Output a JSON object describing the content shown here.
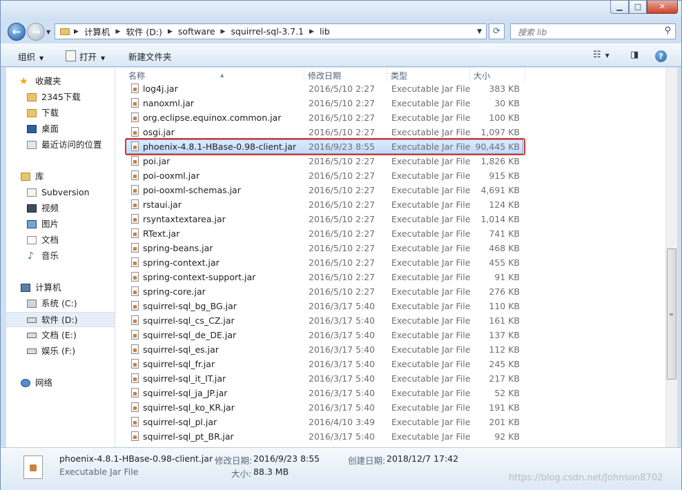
{
  "breadcrumbs": [
    "计算机",
    "软件 (D:)",
    "software",
    "squirrel-sql-3.7.1",
    "lib"
  ],
  "search": {
    "placeholder": "搜索 lib"
  },
  "toolbar": {
    "organize": "组织",
    "open": "打开",
    "new_folder": "新建文件夹"
  },
  "sidebar": {
    "favorites": {
      "label": "收藏夹",
      "items": [
        "2345下载",
        "下载",
        "桌面",
        "最近访问的位置"
      ]
    },
    "libraries": {
      "label": "库",
      "items": [
        "Subversion",
        "视频",
        "图片",
        "文档",
        "音乐"
      ]
    },
    "computer": {
      "label": "计算机",
      "items": [
        "系统 (C:)",
        "软件 (D:)",
        "文档 (E:)",
        "娱乐 (F:)"
      ],
      "selected": "软件 (D:)"
    },
    "network": {
      "label": "网络"
    }
  },
  "columns": {
    "name": "名称",
    "date": "修改日期",
    "type": "类型",
    "size": "大小"
  },
  "files": [
    {
      "name": "log4j.jar",
      "date": "2016/5/10 2:27",
      "type": "Executable Jar File",
      "size": "383 KB"
    },
    {
      "name": "nanoxml.jar",
      "date": "2016/5/10 2:27",
      "type": "Executable Jar File",
      "size": "30 KB"
    },
    {
      "name": "org.eclipse.equinox.common.jar",
      "date": "2016/5/10 2:27",
      "type": "Executable Jar File",
      "size": "100 KB"
    },
    {
      "name": "osgi.jar",
      "date": "2016/5/10 2:27",
      "type": "Executable Jar File",
      "size": "1,097 KB"
    },
    {
      "name": "phoenix-4.8.1-HBase-0.98-client.jar",
      "date": "2016/9/23 8:55",
      "type": "Executable Jar File",
      "size": "90,445 KB",
      "selected": true
    },
    {
      "name": "poi.jar",
      "date": "2016/5/10 2:27",
      "type": "Executable Jar File",
      "size": "1,826 KB"
    },
    {
      "name": "poi-ooxml.jar",
      "date": "2016/5/10 2:27",
      "type": "Executable Jar File",
      "size": "915 KB"
    },
    {
      "name": "poi-ooxml-schemas.jar",
      "date": "2016/5/10 2:27",
      "type": "Executable Jar File",
      "size": "4,691 KB"
    },
    {
      "name": "rstaui.jar",
      "date": "2016/5/10 2:27",
      "type": "Executable Jar File",
      "size": "124 KB"
    },
    {
      "name": "rsyntaxtextarea.jar",
      "date": "2016/5/10 2:27",
      "type": "Executable Jar File",
      "size": "1,014 KB"
    },
    {
      "name": "RText.jar",
      "date": "2016/5/10 2:27",
      "type": "Executable Jar File",
      "size": "741 KB"
    },
    {
      "name": "spring-beans.jar",
      "date": "2016/5/10 2:27",
      "type": "Executable Jar File",
      "size": "468 KB"
    },
    {
      "name": "spring-context.jar",
      "date": "2016/5/10 2:27",
      "type": "Executable Jar File",
      "size": "455 KB"
    },
    {
      "name": "spring-context-support.jar",
      "date": "2016/5/10 2:27",
      "type": "Executable Jar File",
      "size": "91 KB"
    },
    {
      "name": "spring-core.jar",
      "date": "2016/5/10 2:27",
      "type": "Executable Jar File",
      "size": "276 KB"
    },
    {
      "name": "squirrel-sql_bg_BG.jar",
      "date": "2016/3/17 5:40",
      "type": "Executable Jar File",
      "size": "110 KB"
    },
    {
      "name": "squirrel-sql_cs_CZ.jar",
      "date": "2016/3/17 5:40",
      "type": "Executable Jar File",
      "size": "161 KB"
    },
    {
      "name": "squirrel-sql_de_DE.jar",
      "date": "2016/3/17 5:40",
      "type": "Executable Jar File",
      "size": "137 KB"
    },
    {
      "name": "squirrel-sql_es.jar",
      "date": "2016/3/17 5:40",
      "type": "Executable Jar File",
      "size": "112 KB"
    },
    {
      "name": "squirrel-sql_fr.jar",
      "date": "2016/3/17 5:40",
      "type": "Executable Jar File",
      "size": "245 KB"
    },
    {
      "name": "squirrel-sql_it_IT.jar",
      "date": "2016/3/17 5:40",
      "type": "Executable Jar File",
      "size": "217 KB"
    },
    {
      "name": "squirrel-sql_ja_JP.jar",
      "date": "2016/3/17 5:40",
      "type": "Executable Jar File",
      "size": "52 KB"
    },
    {
      "name": "squirrel-sql_ko_KR.jar",
      "date": "2016/3/17 5:40",
      "type": "Executable Jar File",
      "size": "191 KB"
    },
    {
      "name": "squirrel-sql_pl.jar",
      "date": "2016/4/10 3:49",
      "type": "Executable Jar File",
      "size": "201 KB"
    },
    {
      "name": "squirrel-sql_pt_BR.jar",
      "date": "2016/3/17 5:40",
      "type": "Executable Jar File",
      "size": "92 KB"
    }
  ],
  "details": {
    "name": "phoenix-4.8.1-HBase-0.98-client.jar",
    "type": "Executable Jar File",
    "modified_label": "修改日期:",
    "modified_value": "2016/9/23 8:55",
    "created_label": "创建日期:",
    "created_value": "2018/12/7 17:42",
    "size_label": "大小:",
    "size_value": "88.3 MB"
  },
  "watermark": "https://blog.csdn.net/Johnson8702",
  "colors": {
    "selection_border": "#e03030",
    "selected_row": "#c2dcfd"
  }
}
